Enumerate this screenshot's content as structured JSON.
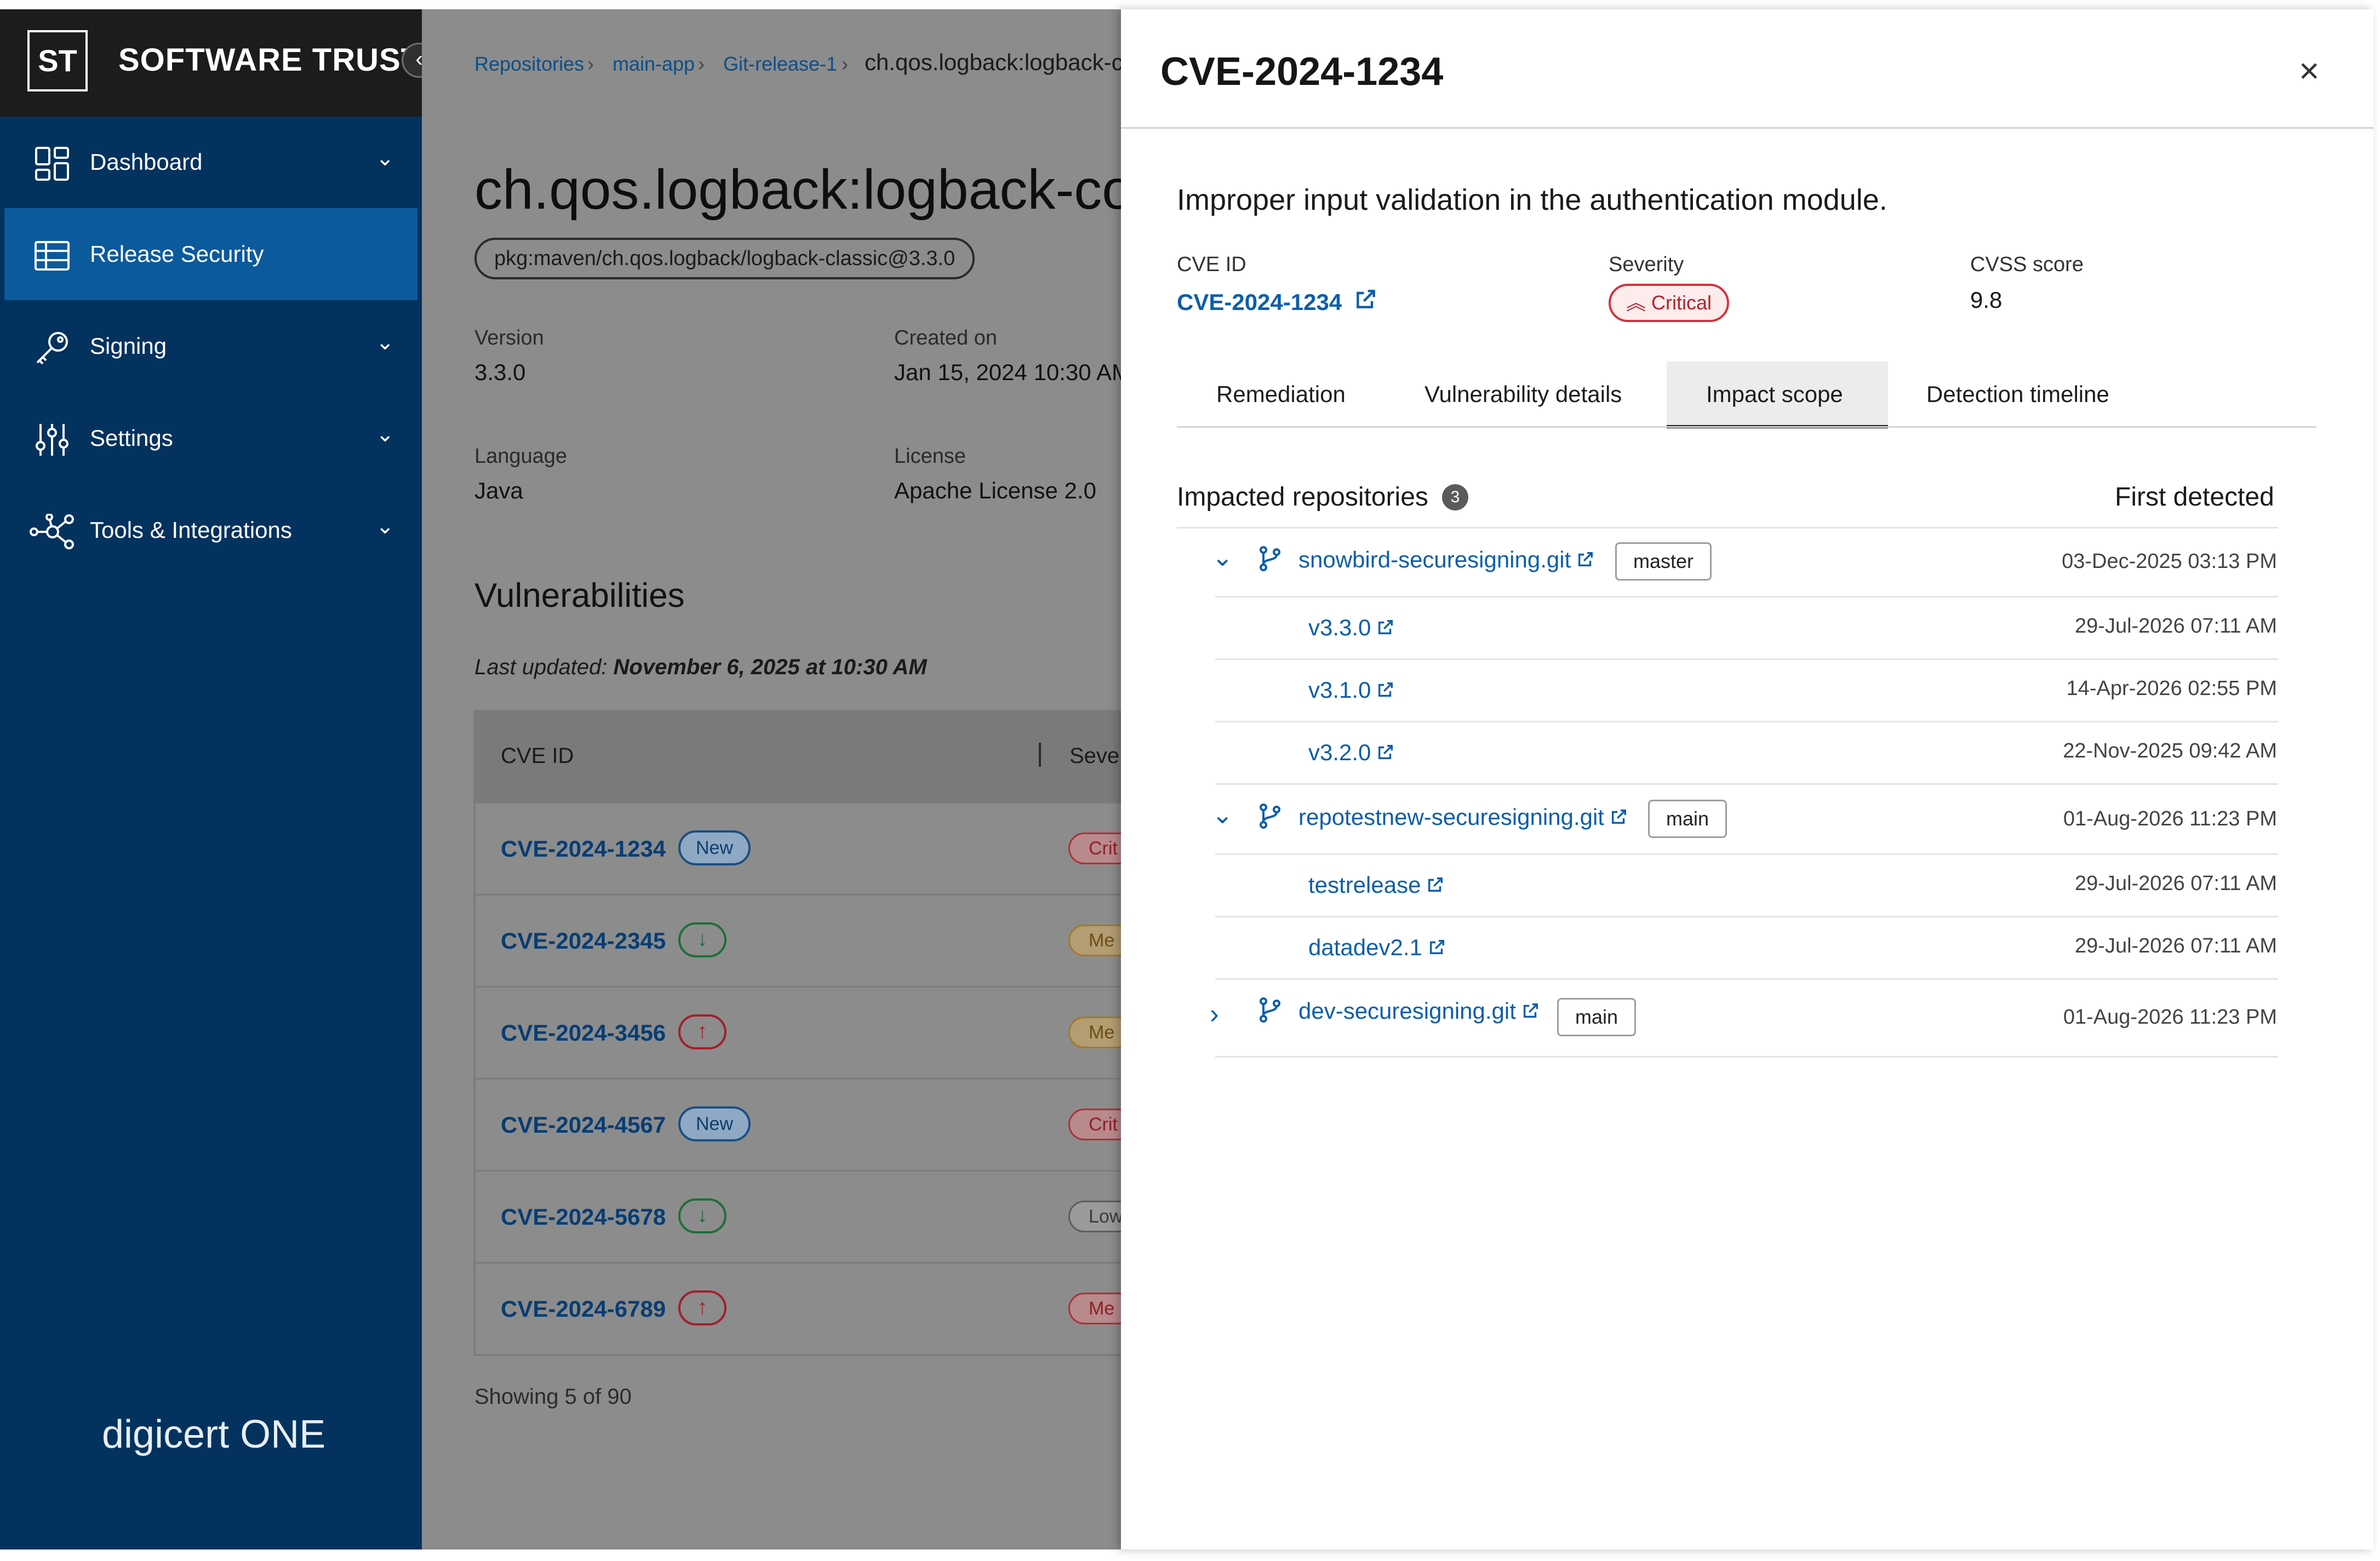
{
  "sidebar": {
    "logo_text": "ST",
    "brand": "SOFTWARE TRUST",
    "items": [
      {
        "label": "Dashboard"
      },
      {
        "label": "Release Security"
      },
      {
        "label": "Signing"
      },
      {
        "label": "Settings"
      },
      {
        "label": "Tools & Integrations"
      }
    ],
    "footer": "digicert ONE"
  },
  "breadcrumb": [
    "Repositories",
    "main-app",
    "Git-release-1",
    "ch.qos.logback:logback-c"
  ],
  "package": {
    "title": "ch.qos.logback:logback-cor",
    "purl": "pkg:maven/ch.qos.logback/logback-classic@3.3.0",
    "version_label": "Version",
    "version": "3.3.0",
    "created_label": "Created on",
    "created": "Jan 15, 2024 10:30 AM",
    "language_label": "Language",
    "language": "Java",
    "license_label": "License",
    "license": "Apache License 2.0"
  },
  "vulnerabilities": {
    "heading": "Vulnerabilities",
    "updated_prefix": "Last updated: ",
    "updated_value": "November 6, 2025 at 10:30 AM",
    "col_cve": "CVE ID",
    "col_sev": "Seve",
    "rows": [
      {
        "cve": "CVE-2024-1234",
        "badge": "New",
        "sev": "Crit"
      },
      {
        "cve": "CVE-2024-2345",
        "badge": "↓",
        "sev": "Me"
      },
      {
        "cve": "CVE-2024-3456",
        "badge": "↑",
        "sev": "Me"
      },
      {
        "cve": "CVE-2024-4567",
        "badge": "New",
        "sev": "Crit"
      },
      {
        "cve": "CVE-2024-5678",
        "badge": "↓",
        "sev": "Low"
      },
      {
        "cve": "CVE-2024-6789",
        "badge": "↑",
        "sev": "Me"
      }
    ],
    "showing": "Showing 5 of 90"
  },
  "panel": {
    "title": "CVE-2024-1234",
    "close": "×",
    "description": "Improper input validation in the authentication module.",
    "cve_id_label": "CVE ID",
    "cve_id": "CVE-2024-1234",
    "severity_label": "Severity",
    "severity": "Critical",
    "cvss_label": "CVSS score",
    "cvss": "9.8",
    "tabs": [
      "Remediation",
      "Vulnerability details",
      "Impact scope",
      "Detection timeline"
    ],
    "impacted_title": "Impacted repositories",
    "impacted_count": "3",
    "first_detected": "First detected",
    "repos": [
      {
        "name": "snowbird-securesigning.git",
        "branch": "master",
        "date": "03-Dec-2025 03:13 PM",
        "refs": [
          {
            "name": "v3.3.0",
            "date": "29-Jul-2026 07:11 AM"
          },
          {
            "name": "v3.1.0",
            "date": "14-Apr-2026 02:55 PM"
          },
          {
            "name": "v3.2.0",
            "date": "22-Nov-2025 09:42 AM"
          }
        ]
      },
      {
        "name": "repotestnew-securesigning.git",
        "branch": "main",
        "date": "01-Aug-2026 11:23 PM",
        "refs": [
          {
            "name": "testrelease",
            "date": "29-Jul-2026 07:11 AM"
          },
          {
            "name": "datadev2.1",
            "date": "29-Jul-2026 07:11 AM"
          }
        ]
      },
      {
        "name": "dev-securesigning.git",
        "branch": "main",
        "date": "01-Aug-2026 11:23 PM",
        "refs": []
      }
    ]
  },
  "colors": {
    "sidebar": "#03325e",
    "sidebar_active": "#0b5a9c",
    "link": "#0c5ea8",
    "critical": "#d0343e"
  }
}
